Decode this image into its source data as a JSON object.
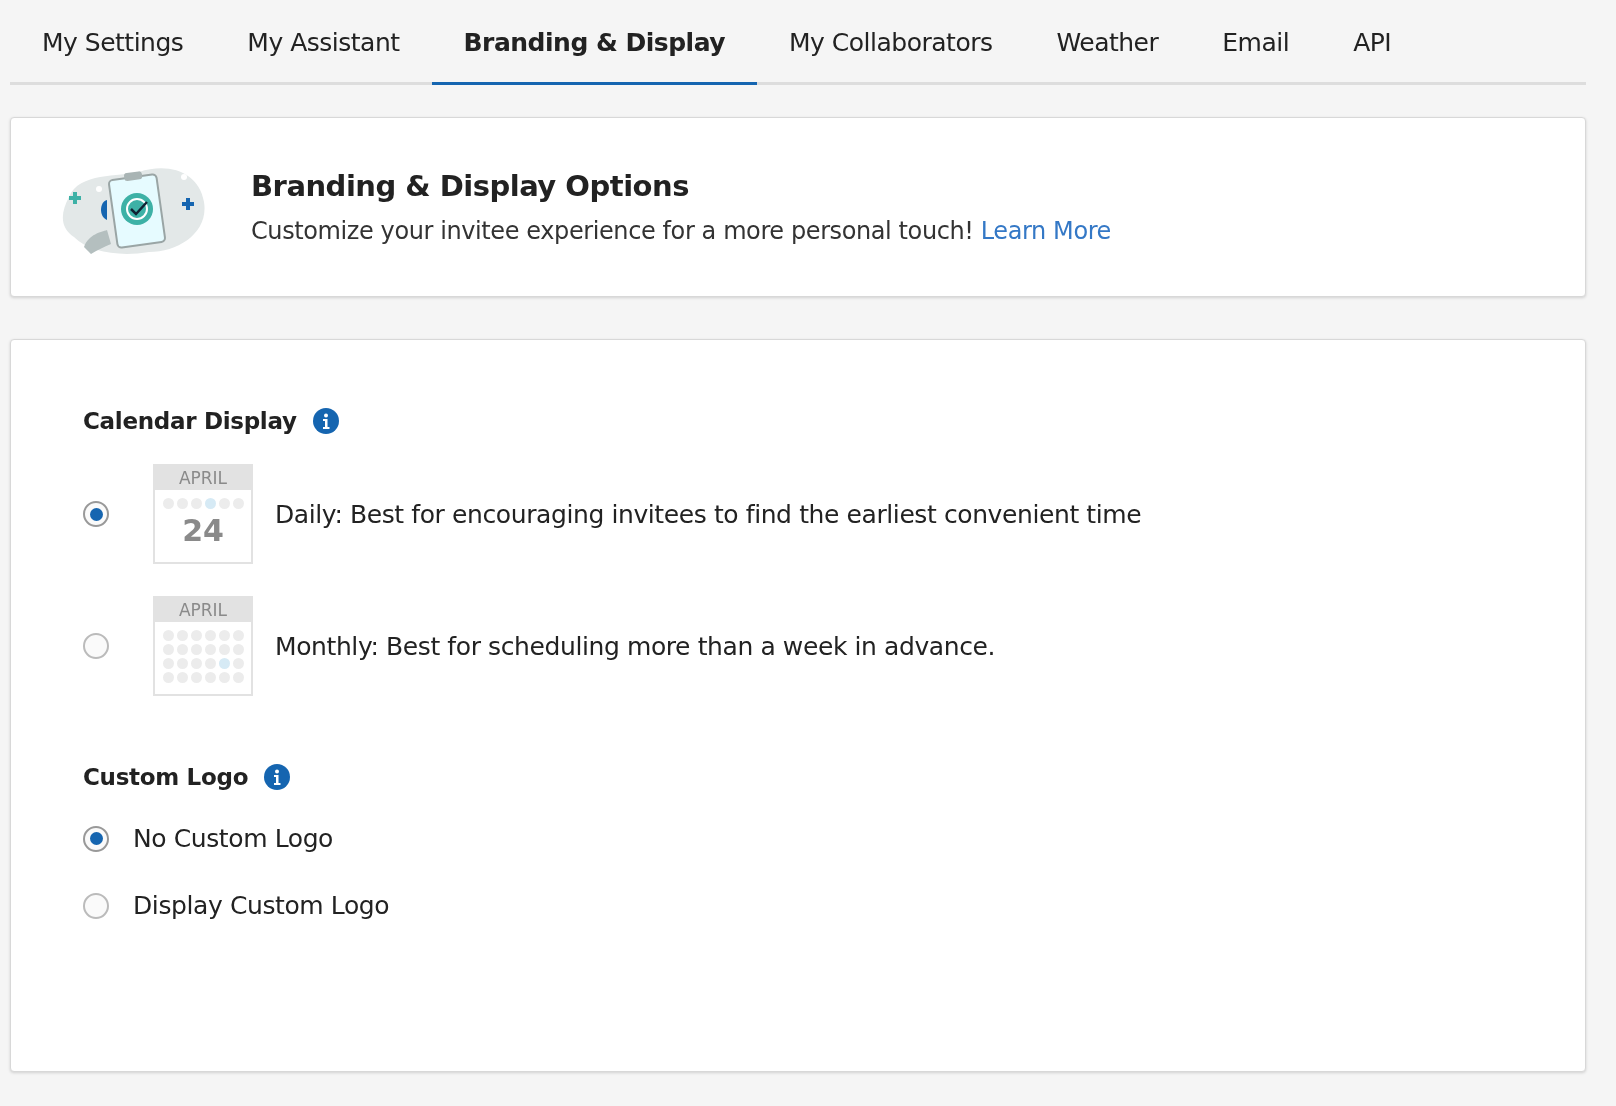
{
  "tabs": [
    {
      "label": "My Settings",
      "selected": false
    },
    {
      "label": "My Assistant",
      "selected": false
    },
    {
      "label": "Branding & Display",
      "selected": true
    },
    {
      "label": "My Collaborators",
      "selected": false
    },
    {
      "label": "Weather",
      "selected": false
    },
    {
      "label": "Email",
      "selected": false
    },
    {
      "label": "API",
      "selected": false
    }
  ],
  "intro": {
    "title": "Branding & Display Options",
    "text": "Customize your invitee experience for a more personal touch!",
    "link": "Learn More"
  },
  "calendar_display": {
    "title": "Calendar Display",
    "options": [
      {
        "kind": "daily",
        "month": "APRIL",
        "day": "24",
        "label": "Daily: Best for encouraging invitees to find the earliest convenient time",
        "selected": true
      },
      {
        "kind": "monthly",
        "month": "APRIL",
        "label": "Monthly: Best for scheduling more than a week in advance.",
        "selected": false
      }
    ]
  },
  "custom_logo": {
    "title": "Custom Logo",
    "options": [
      {
        "label": "No Custom Logo",
        "selected": true
      },
      {
        "label": "Display Custom Logo",
        "selected": false
      }
    ]
  }
}
